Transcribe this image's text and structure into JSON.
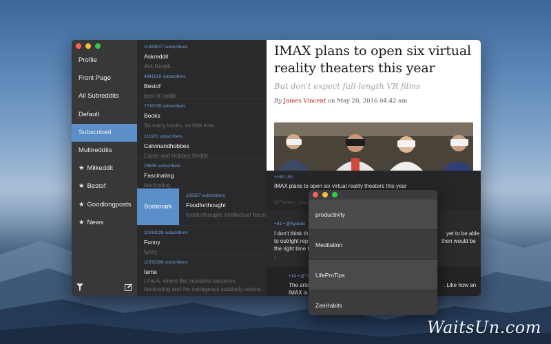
{
  "sidebar": {
    "items": [
      {
        "label": "Profile",
        "star": false
      },
      {
        "label": "Front Page",
        "star": false
      },
      {
        "label": "All Subreddits",
        "star": false
      },
      {
        "label": "Default",
        "star": false
      },
      {
        "label": "Subscribed",
        "star": false,
        "active": true
      },
      {
        "label": "Multireddits",
        "star": false
      },
      {
        "label": "Milkeddit",
        "star": true
      },
      {
        "label": "Bestof",
        "star": true
      },
      {
        "label": "Goodlongposts",
        "star": true
      },
      {
        "label": "News",
        "star": true
      }
    ],
    "star_glyph": "★",
    "bottom_icons": [
      "filter-icon",
      "compose-icon"
    ]
  },
  "subreddits": [
    {
      "count": "11493017 subscribers",
      "name": "Askreddit",
      "desc": "Ask Reddit..."
    },
    {
      "count": "4641010 subscribers",
      "name": "Bestof",
      "desc": "best of reddit"
    },
    {
      "count": "7738735 subscribers",
      "name": "Books",
      "desc": "So many books, so little time"
    },
    {
      "count": "111621 subscribers",
      "name": "Calvinandhobbes",
      "desc": "Calvin and Hobbes Reddit"
    },
    {
      "count": "29845 subscribers",
      "name": "Fascinating",
      "desc": "fascinating"
    },
    {
      "count": "155327 subscribers",
      "name": "Foodforthought",
      "desc": "foodforthought: Intellectual Nourishment",
      "swipe_action": "Bookmark"
    },
    {
      "count": "11414229 subscribers",
      "name": "Funny",
      "desc": "funny"
    },
    {
      "count": "11032286 subscribers",
      "name": "Iama",
      "desc": "I Am A, where the mundane becomes fascinating and the outrageous suddenly seems normal"
    }
  ],
  "article": {
    "headline": "IMAX plans to open six virtual reality theaters this year",
    "subhead": "But don't expect full-length VR films",
    "by_label": "By",
    "author": "James Vincent",
    "on_label": "on",
    "date": "May 20, 2016 04:42 am"
  },
  "post": {
    "score": "+160 | 50",
    "title": "IMAX plans to open six virtual reality theaters this year",
    "meta": "@Thomas_Cove..."
  },
  "comments": [
    {
      "meta": "+41 • @Kyoraki",
      "text_left": "I don't think th",
      "text_left2": "to outright rep",
      "text_left3": "the right time t",
      "text_right": "yet to be able",
      "text_right2": "then would be"
    },
    {
      "meta": "+14 • @Th",
      "text_left": "The artic",
      "text_left2": "IMAX is",
      "text_right": ". Like how an"
    }
  ],
  "popup": {
    "items": [
      "productivity",
      "Meditation",
      "LifeProTips",
      "ZenHabits"
    ]
  },
  "watermark": "WaitsUn.com",
  "colors": {
    "accent": "#5a8fca",
    "author": "#b3161b",
    "count": "#6ea0d8"
  }
}
